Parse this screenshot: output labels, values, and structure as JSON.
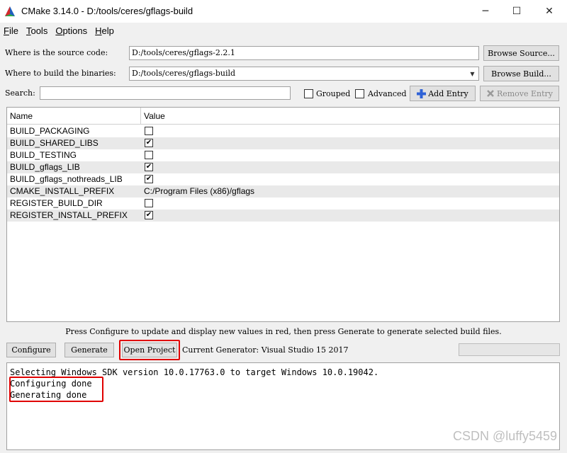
{
  "window": {
    "title": "CMake 3.14.0 - D:/tools/ceres/gflags-build",
    "minimize_glyph": "─",
    "maximize_glyph": "☐",
    "close_glyph": "✕"
  },
  "menu": [
    {
      "label": "File"
    },
    {
      "label": "Tools"
    },
    {
      "label": "Options"
    },
    {
      "label": "Help"
    }
  ],
  "source": {
    "label": "Where is the source code:",
    "value": "D:/tools/ceres/gflags-2.2.1",
    "browse_label": "Browse Source..."
  },
  "build": {
    "label": "Where to build the binaries:",
    "value": "D:/tools/ceres/gflags-build",
    "browse_label": "Browse Build..."
  },
  "search": {
    "label": "Search:",
    "value": "",
    "grouped_label": "Grouped",
    "grouped_checked": false,
    "advanced_label": "Advanced",
    "advanced_checked": false,
    "add_entry_label": "Add Entry",
    "remove_entry_label": "Remove Entry"
  },
  "table": {
    "columns": [
      "Name",
      "Value"
    ],
    "rows": [
      {
        "name": "BUILD_PACKAGING",
        "type": "bool",
        "checked": false
      },
      {
        "name": "BUILD_SHARED_LIBS",
        "type": "bool",
        "checked": true
      },
      {
        "name": "BUILD_TESTING",
        "type": "bool",
        "checked": false
      },
      {
        "name": "BUILD_gflags_LIB",
        "type": "bool",
        "checked": true
      },
      {
        "name": "BUILD_gflags_nothreads_LIB",
        "type": "bool",
        "checked": true
      },
      {
        "name": "CMAKE_INSTALL_PREFIX",
        "type": "path",
        "value": "C:/Program Files (x86)/gflags"
      },
      {
        "name": "REGISTER_BUILD_DIR",
        "type": "bool",
        "checked": false
      },
      {
        "name": "REGISTER_INSTALL_PREFIX",
        "type": "bool",
        "checked": true
      }
    ]
  },
  "hint": "Press Configure to update and display new values in red, then press Generate to generate selected build files.",
  "actions": {
    "configure_label": "Configure",
    "generate_label": "Generate",
    "open_project_label": "Open Project",
    "generator_text": "Current Generator: Visual Studio 15 2017"
  },
  "output": {
    "lines": [
      "Selecting Windows SDK version 10.0.17763.0 to target Windows 10.0.19042.",
      "Configuring done",
      "Generating done"
    ]
  },
  "watermark": "CSDN @luffy5459",
  "colors": {
    "highlight_box": "#e00000",
    "row_alt": "#e9e9e9"
  }
}
